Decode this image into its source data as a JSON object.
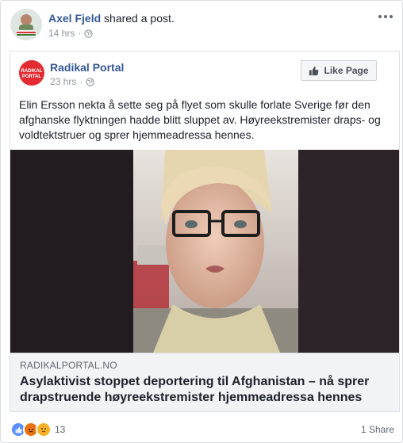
{
  "header": {
    "author": "Axel Fjeld",
    "action": "shared a post.",
    "time": "14 hrs"
  },
  "shared_post": {
    "page_name": "Radikal Portal",
    "page_logo_text": "RADIKAL PORTAL",
    "time": "23 hrs",
    "like_button": "Like Page",
    "text": "Elin Ersson nekta å sette seg på flyet som skulle forlate Sverige før den afghanske flyktningen hadde blitt sluppet av. Høyreekstremister draps- og voldtektstruer og sprer hjemmeadressa hennes.",
    "link": {
      "domain": "RADIKALPORTAL.NO",
      "title": "Asylaktivist stoppet deportering til Afghanistan – nå sprer drapstruende høyreekstremister hjemmeadressa hennes"
    }
  },
  "footer": {
    "reaction_count": "13",
    "shares": "1 Share"
  }
}
